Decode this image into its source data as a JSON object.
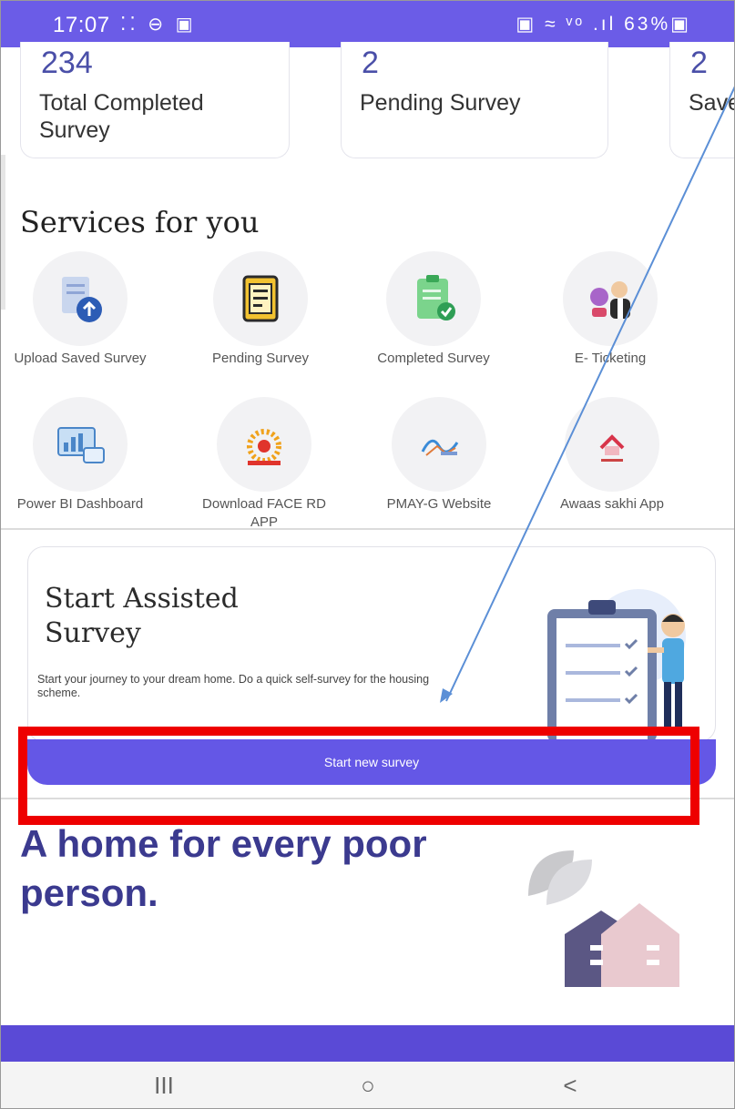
{
  "status_bar": {
    "time": "17:07",
    "left_icons": "⁚⁚ ⊖ ▣",
    "right_icons": "▣ ≈ ᵛᵒ .ıl 63%▣",
    "background": "#6b5ce7"
  },
  "stats": [
    {
      "value": "234",
      "label": "Total Completed Survey"
    },
    {
      "value": "2",
      "label": "Pending Survey"
    },
    {
      "value": "2",
      "label": "Save"
    }
  ],
  "services": {
    "title": "Services for you",
    "items": [
      {
        "label": "Upload Saved Survey",
        "icon": "upload-document-icon"
      },
      {
        "label": "Pending Survey",
        "icon": "pending-document-icon"
      },
      {
        "label": "Completed Survey",
        "icon": "completed-checklist-icon"
      },
      {
        "label": "E- Ticketing",
        "icon": "support-agent-icon"
      },
      {
        "label": "Power BI Dashboard",
        "icon": "dashboard-chart-icon"
      },
      {
        "label": "Download FACE RD APP",
        "icon": "aadhaar-logo-icon"
      },
      {
        "label": "PMAY-G Website",
        "icon": "pmay-logo-icon"
      },
      {
        "label": "Awaas sakhi App",
        "icon": "awaas-sakhi-logo-icon"
      }
    ]
  },
  "assisted_survey": {
    "title": "Start Assisted Survey",
    "description": "Start your journey to your dream home. Do a quick self-survey for the housing scheme.",
    "button_label": "Start new survey"
  },
  "tagline": "A home for every poor person.",
  "nav": {
    "recents": "III",
    "home": "○",
    "back": "<"
  },
  "colors": {
    "accent": "#6457e6",
    "highlight": "#ee0000",
    "arrow": "#5b8fd6",
    "tagline": "#3b3a8f"
  }
}
